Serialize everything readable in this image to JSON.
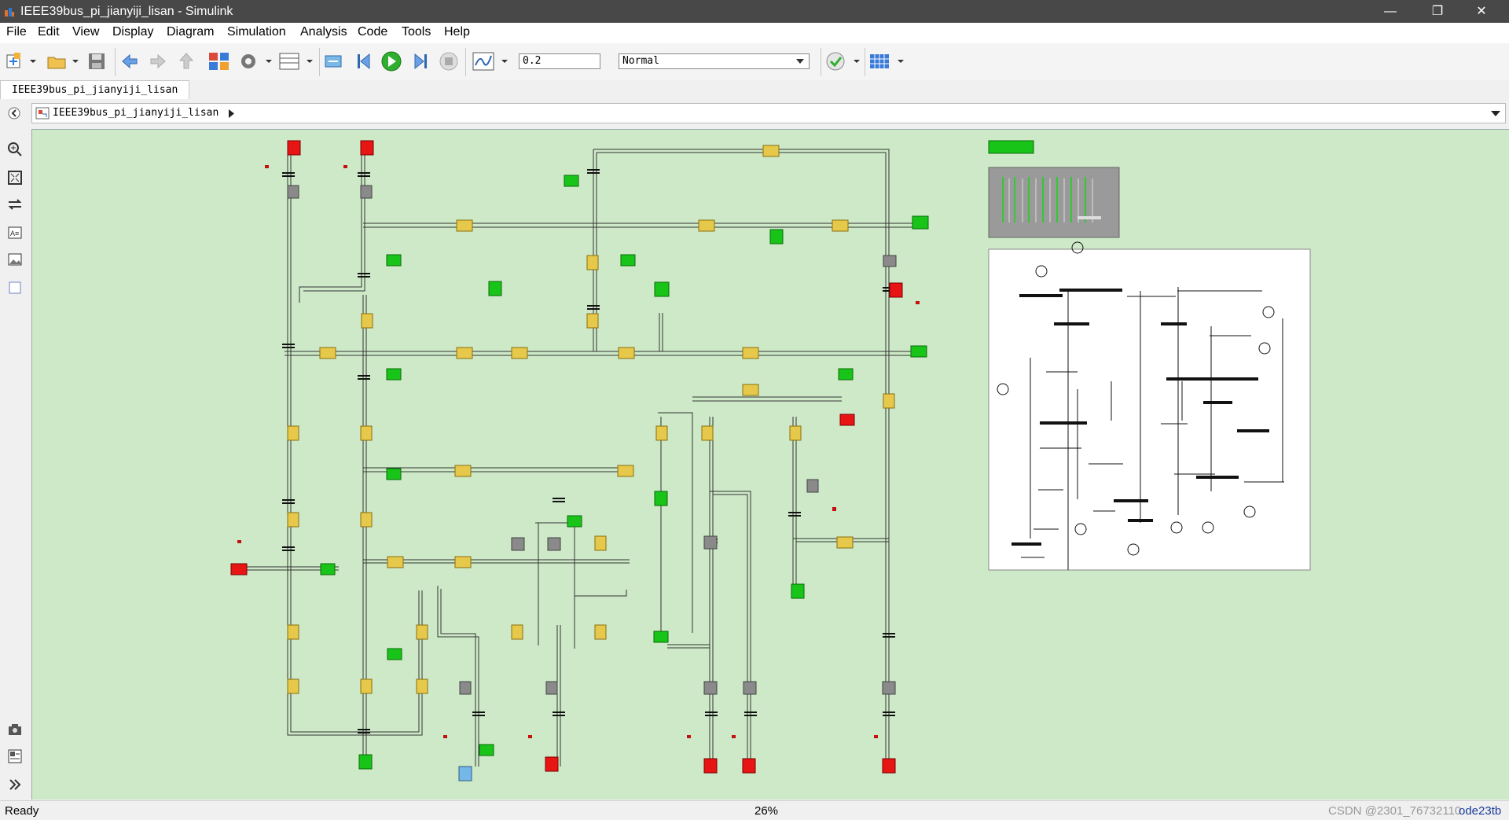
{
  "window": {
    "title": "IEEE39bus_pi_jianyiji_lisan - Simulink"
  },
  "menu": [
    "File",
    "Edit",
    "View",
    "Display",
    "Diagram",
    "Simulation",
    "Analysis",
    "Code",
    "Tools",
    "Help"
  ],
  "toolbar": {
    "stop_time": "0.2",
    "sim_mode": "Normal"
  },
  "tabs": [
    {
      "label": "IEEE39bus_pi_jianyiji_lisan"
    }
  ],
  "breadcrumb": {
    "model": "IEEE39bus_pi_jianyiji_lisan"
  },
  "status": {
    "left": "Ready",
    "zoom": "26%",
    "solver": "ode23tb",
    "watermark": "CSDN @2301_76732110"
  },
  "colors": {
    "canvas_bg": "#cde9c7",
    "source_red": "#e81515",
    "load_green": "#18c418",
    "line_yellow": "#e6c84a",
    "bus_gray": "#8a8a8a",
    "light_blue": "#74b8ea"
  },
  "icons": [
    "new-model-icon",
    "open-icon",
    "save-icon",
    "back-icon",
    "forward-icon",
    "up-icon",
    "library-browser-icon",
    "settings-icon",
    "explorer-icon",
    "step-back-icon",
    "run-icon",
    "step-forward-icon",
    "stop-icon",
    "scope-icon",
    "check-icon",
    "grid-icon",
    "zoom-in-icon",
    "fit-view-icon",
    "arrows-icon",
    "annotation-icon",
    "image-icon",
    "area-icon",
    "camera-icon",
    "explorer-bar-icon",
    "expand-icon"
  ]
}
